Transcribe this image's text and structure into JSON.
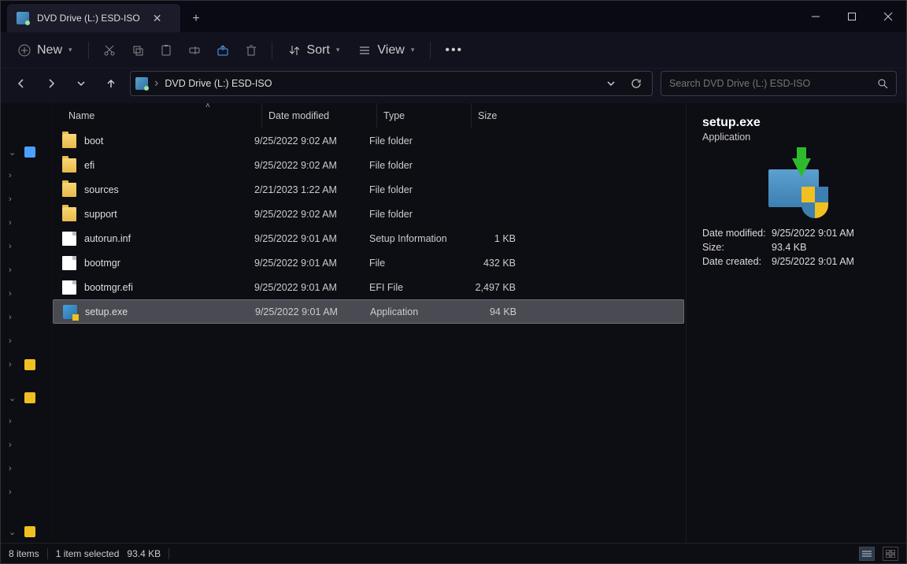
{
  "window": {
    "tab_title": "DVD Drive (L:) ESD-ISO"
  },
  "toolbar": {
    "new_label": "New",
    "sort_label": "Sort",
    "view_label": "View"
  },
  "addressbar": {
    "crumb": "DVD Drive (L:) ESD-ISO"
  },
  "search": {
    "placeholder": "Search DVD Drive (L:) ESD-ISO"
  },
  "columns": {
    "name": "Name",
    "date": "Date modified",
    "type": "Type",
    "size": "Size"
  },
  "files": [
    {
      "name": "boot",
      "date": "9/25/2022 9:02 AM",
      "type": "File folder",
      "size": "",
      "icon": "folder"
    },
    {
      "name": "efi",
      "date": "9/25/2022 9:02 AM",
      "type": "File folder",
      "size": "",
      "icon": "folder"
    },
    {
      "name": "sources",
      "date": "2/21/2023 1:22 AM",
      "type": "File folder",
      "size": "",
      "icon": "folder"
    },
    {
      "name": "support",
      "date": "9/25/2022 9:02 AM",
      "type": "File folder",
      "size": "",
      "icon": "folder"
    },
    {
      "name": "autorun.inf",
      "date": "9/25/2022 9:01 AM",
      "type": "Setup Information",
      "size": "1 KB",
      "icon": "file"
    },
    {
      "name": "bootmgr",
      "date": "9/25/2022 9:01 AM",
      "type": "File",
      "size": "432 KB",
      "icon": "file"
    },
    {
      "name": "bootmgr.efi",
      "date": "9/25/2022 9:01 AM",
      "type": "EFI File",
      "size": "2,497 KB",
      "icon": "file"
    },
    {
      "name": "setup.exe",
      "date": "9/25/2022 9:01 AM",
      "type": "Application",
      "size": "94 KB",
      "icon": "setup",
      "selected": true
    }
  ],
  "details": {
    "title": "setup.exe",
    "subtitle": "Application",
    "modified_label": "Date modified:",
    "modified": "9/25/2022 9:01 AM",
    "size_label": "Size:",
    "size": "93.4 KB",
    "created_label": "Date created:",
    "created": "9/25/2022 9:01 AM"
  },
  "status": {
    "count": "8 items",
    "selection": "1 item selected",
    "size": "93.4 KB"
  }
}
